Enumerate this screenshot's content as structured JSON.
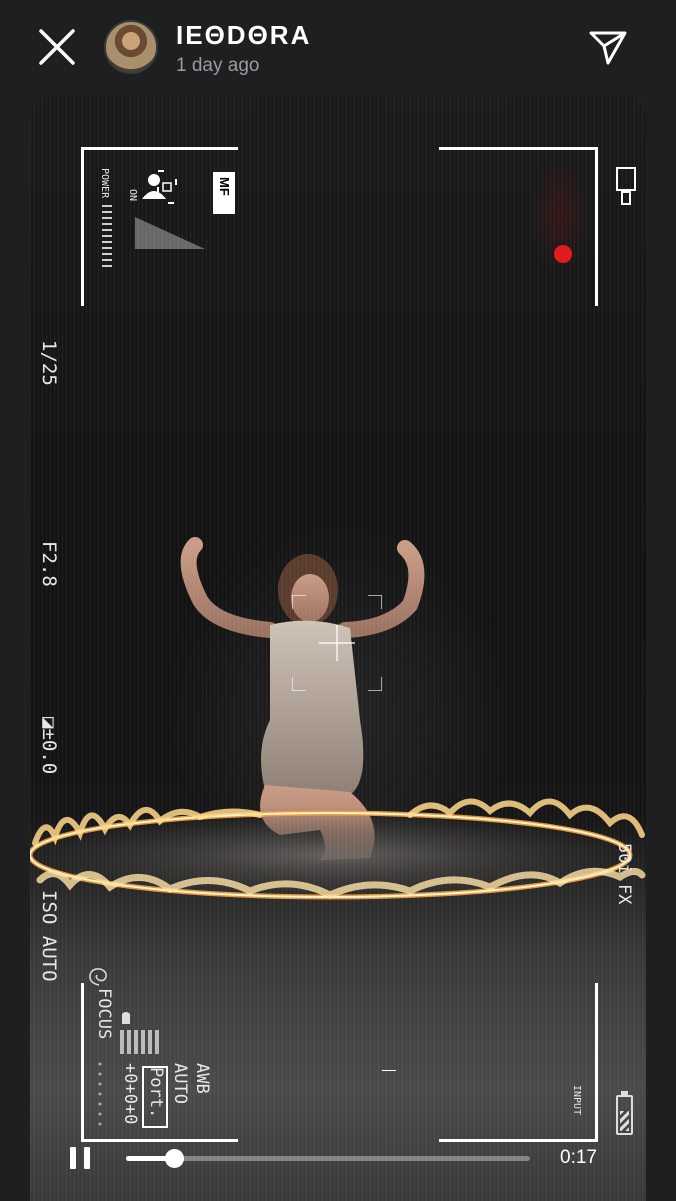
{
  "header": {
    "username": "IEΘDΘRA",
    "timestamp": "1 day ago",
    "close_icon": "close-icon",
    "send_icon": "send-icon"
  },
  "overlay": {
    "power_label": "POWER",
    "on_label": "ON",
    "mf_label": "MF",
    "shutter": "1/25",
    "aperture": "F2.8",
    "exposure": "◪±0.0",
    "iso": "ISO AUTO",
    "focus": "FOCUS",
    "awb": "AWB",
    "auto": "AUTO",
    "port": "Port.",
    "offset": "+0+0+0",
    "input_label": "INPUT",
    "fps": "50i FX",
    "rec_color": "#e01b22"
  },
  "player": {
    "time": "0:17",
    "progress": 0.12
  }
}
